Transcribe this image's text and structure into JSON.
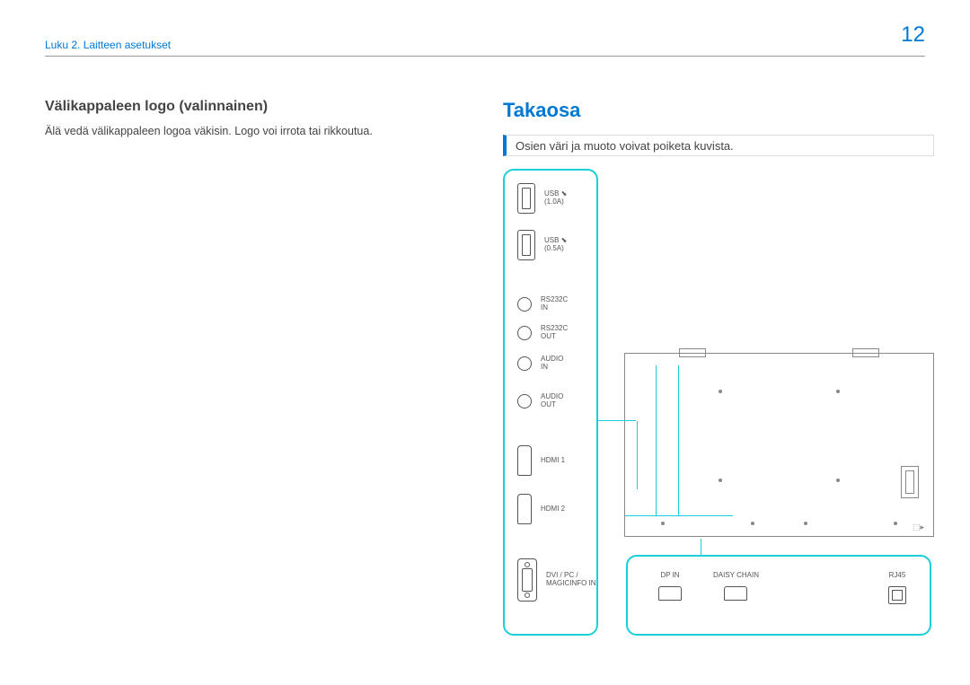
{
  "header": {
    "chapter": "Luku 2. Laitteen asetukset",
    "page_number": "12"
  },
  "left": {
    "heading": "Välikappaleen logo (valinnainen)",
    "body": "Älä vedä välikappaleen logoa väkisin. Logo voi irrota tai rikkoutua."
  },
  "right": {
    "heading": "Takaosa",
    "note": "Osien väri ja muoto voivat poiketa kuvista."
  },
  "ports": {
    "usb1": {
      "line1": "USB",
      "line2": "(1.0A)"
    },
    "usb2": {
      "line1": "USB",
      "line2": "(0.5A)"
    },
    "rs_in": {
      "line1": "RS232C",
      "line2": "IN"
    },
    "rs_out": {
      "line1": "RS232C",
      "line2": "OUT"
    },
    "audio_in": {
      "line1": "AUDIO",
      "line2": "IN"
    },
    "audio_out": {
      "line1": "AUDIO",
      "line2": "OUT"
    },
    "hdmi1": "HDMI 1",
    "hdmi2": "HDMI 2",
    "dvi": {
      "line1": "DVI / PC /",
      "line2": "MAGICINFO IN"
    }
  },
  "bottom": {
    "dp_in": "DP IN",
    "daisy": "DAISY CHAIN",
    "rj45": "RJ45"
  }
}
